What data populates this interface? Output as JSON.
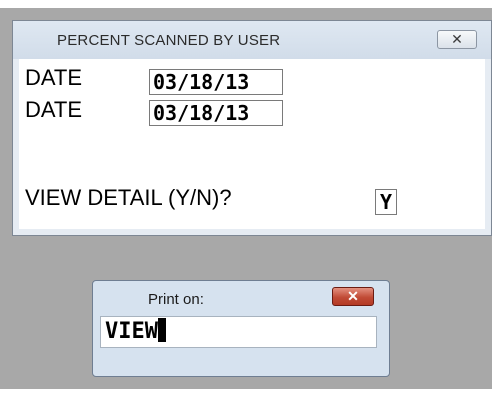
{
  "main_dialog": {
    "title": "PERCENT SCANNED BY USER",
    "close_glyph": "✕",
    "fields": [
      {
        "label": "DATE",
        "value": "03/18/13"
      },
      {
        "label": "DATE",
        "value": "03/18/13"
      }
    ],
    "view_detail": {
      "label": "VIEW DETAIL (Y/N)?",
      "value": "Y"
    }
  },
  "print_dialog": {
    "title": "Print on:",
    "close_glyph": "✕",
    "input_value": "VIEW",
    "close_color": "#c14b36"
  }
}
